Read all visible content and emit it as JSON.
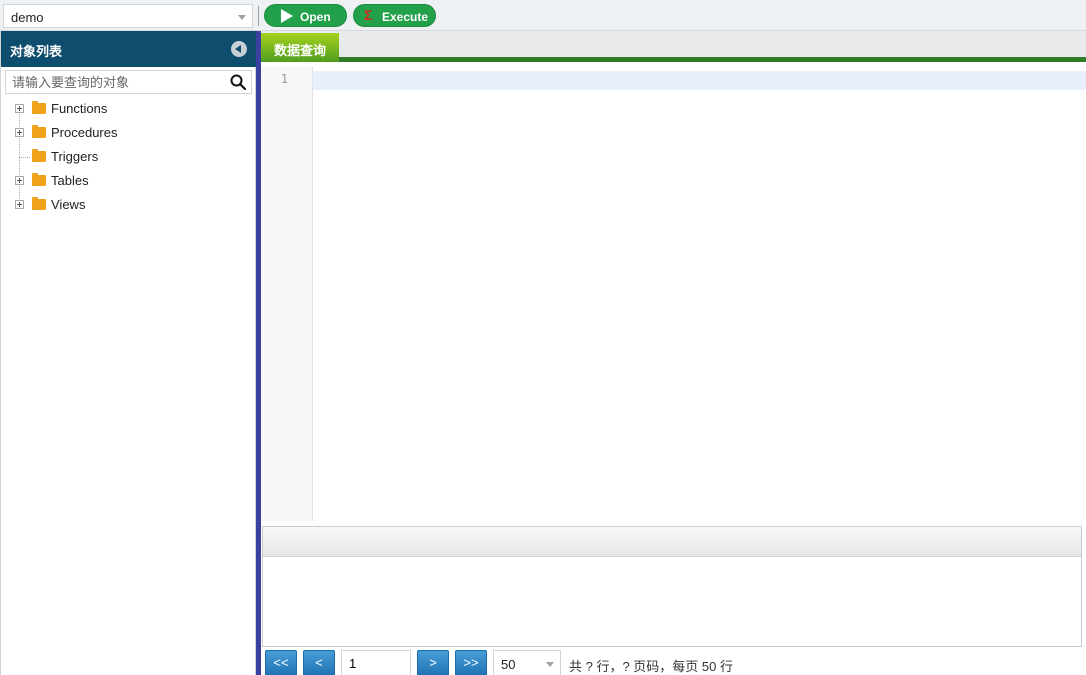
{
  "toolbar": {
    "database": "demo",
    "open_label": "Open",
    "execute_label": "Execute",
    "execute_icon": "Σ"
  },
  "left_panel": {
    "title": "对象列表",
    "search_placeholder": "请输入要查询的对象",
    "tree": [
      {
        "label": "Functions",
        "expandable": true
      },
      {
        "label": "Procedures",
        "expandable": true
      },
      {
        "label": "Triggers",
        "expandable": false
      },
      {
        "label": "Tables",
        "expandable": true
      },
      {
        "label": "Views",
        "expandable": true
      }
    ]
  },
  "tabs": [
    {
      "label": "数据查询",
      "active": true
    }
  ],
  "editor": {
    "line_numbers": [
      "1"
    ],
    "content": ""
  },
  "pager": {
    "first_label": "<<",
    "prev_label": "<",
    "page_value": "1",
    "next_label": ">",
    "last_label": ">>",
    "page_size": "50",
    "info": "共 ? 行，? 页码，每页 50 行"
  },
  "colors": {
    "header_bg": "#0f4d6e",
    "button_green": "#23a04a",
    "tab_green": "#4f9d1f",
    "pager_blue": "#1f74b5",
    "splitter": "#3b3fa0",
    "folder": "#f0a21b"
  }
}
